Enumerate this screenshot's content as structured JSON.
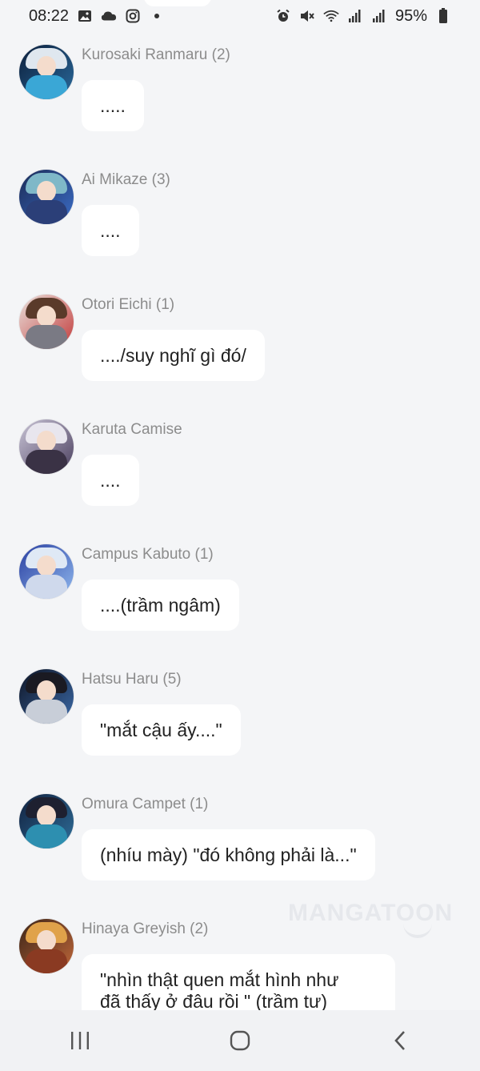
{
  "status_bar": {
    "time": "08:22",
    "battery": "95%",
    "left_icons": [
      "image-icon",
      "cloud-icon",
      "instagram-icon",
      "dot-icon"
    ],
    "right_icons": [
      "alarm-icon",
      "mute-icon",
      "wifi-icon",
      "signal-icon",
      "signal-icon",
      "battery-icon"
    ]
  },
  "messages": [
    {
      "name": "Kurosaki Ranmaru (2)",
      "text": "....."
    },
    {
      "name": "Ai Mikaze (3)",
      "text": "...."
    },
    {
      "name": "Otori Eichi (1)",
      "text": "..../suy nghĩ gì đó/"
    },
    {
      "name": "Karuta Camise",
      "text": "...."
    },
    {
      "name": "Campus Kabuto (1)",
      "text": "....(trầm ngâm)"
    },
    {
      "name": "Hatsu Haru (5)",
      "text": "\"mắt cậu ấy....\""
    },
    {
      "name": "Omura Campet (1)",
      "text": "(nhíu mày) \"đó không phải là...\""
    },
    {
      "name": "Hinaya Greyish (2)",
      "text_line1": "\"nhìn thật quen mắt hình như",
      "text_line2": "đã thấy ở đâu rồi \" (trầm tư)"
    }
  ],
  "watermark": "MANGATOON",
  "nav_bar": {
    "buttons": [
      "recent-apps-icon",
      "home-icon",
      "back-icon"
    ]
  },
  "colors": {
    "background": "#f4f5f7",
    "bubble": "#ffffff",
    "name_text": "#8c8c8c"
  }
}
